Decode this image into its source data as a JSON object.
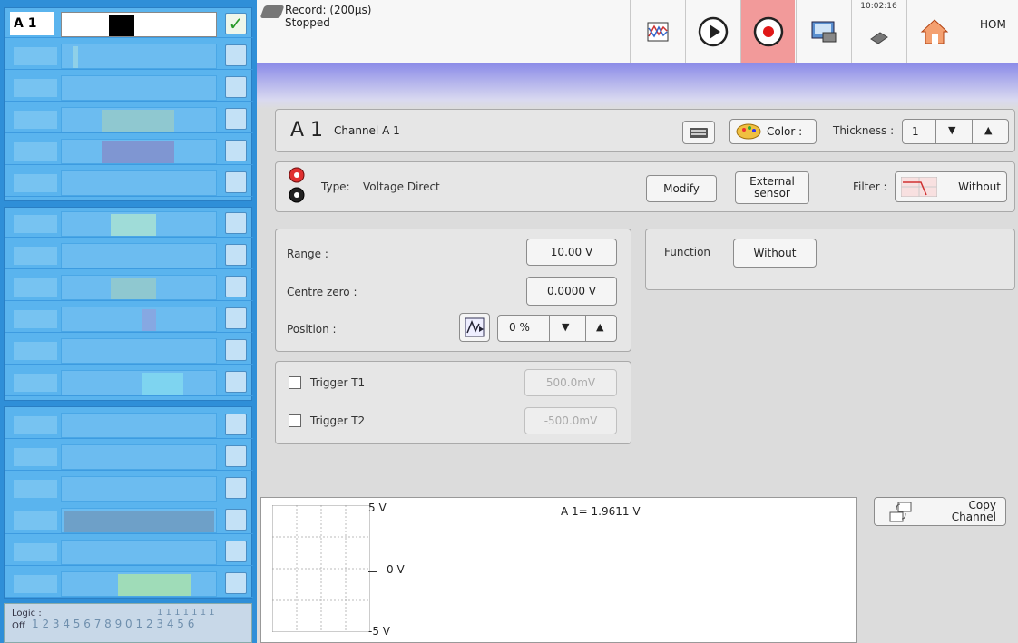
{
  "sidebar": {
    "active_label": "A 1",
    "logic_label": "Logic :",
    "logic_state": "Off",
    "logic_numbers_top": "1 1 1 1 1 1 1",
    "logic_numbers": "1 2 3 4 5 6 7 8 9 0 1 2 3 4 5 6"
  },
  "topbar": {
    "record_text": "Record: (200µs)\nStopped",
    "clock": "10:02:16",
    "home_label": "HOM"
  },
  "channel": {
    "id": "A 1",
    "name": "Channel A 1",
    "color_button": "Color :",
    "thickness_label": "Thickness :",
    "thickness_value": "1"
  },
  "type_row": {
    "type_label": "Type:",
    "type_value": "Voltage Direct",
    "modify_button": "Modify",
    "external_sensor_button": "External\nsensor",
    "filter_label": "Filter :",
    "filter_value": "Without"
  },
  "range_panel": {
    "range_label": "Range :",
    "range_value": "10.00 V",
    "centre_zero_label": "Centre zero :",
    "centre_zero_value": "0.0000 V",
    "position_label": "Position :",
    "position_value": "0 %"
  },
  "function_panel": {
    "function_label": "Function",
    "function_value": "Without"
  },
  "trigger_panel": {
    "t1_label": "Trigger T1",
    "t1_value": "500.0mV",
    "t2_label": "Trigger T2",
    "t2_value": "-500.0mV"
  },
  "preview": {
    "top_label": "5 V",
    "mid_label": "0 V",
    "bottom_label": "-5 V",
    "measurement": "A 1= 1.9611 V"
  },
  "copy_channel_button": "Copy\nChannel"
}
